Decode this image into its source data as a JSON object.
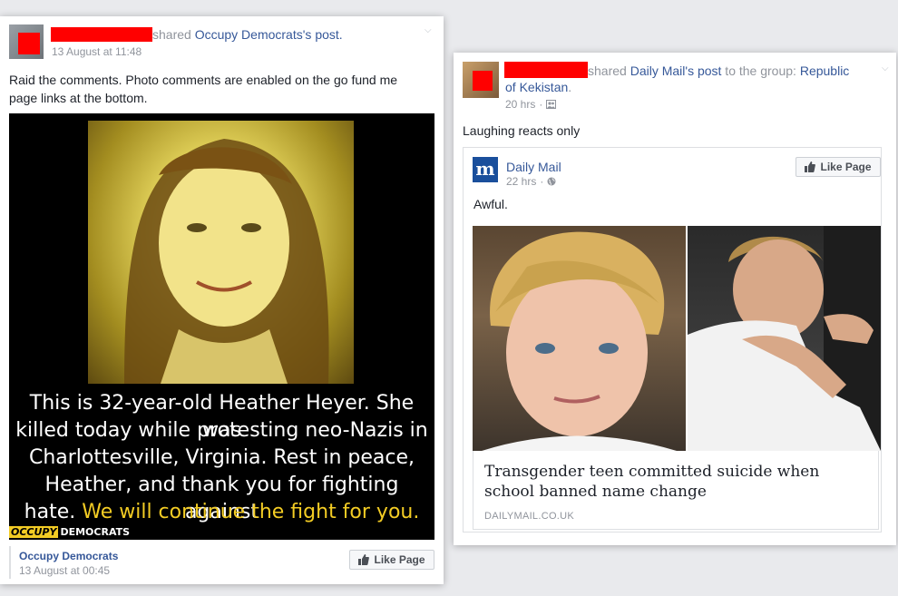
{
  "left_post": {
    "shared_prefix": "shared ",
    "page_name": "Occupy Democrats",
    "shared_suffix": "'s post.",
    "timestamp": "13 August at 11:48",
    "text_line1": "Raid the comments. Photo comments are enabled on the go fund me",
    "text_line2": "page links at the bottom.",
    "caption_line1": "This is 32-year-old Heather Heyer. She was",
    "caption_line2": "killed today while protesting neo-Nazis in",
    "caption_line3": "Charlottesville, Virginia. Rest in peace,",
    "caption_line4": "Heather, and thank you for fighting against",
    "caption_line5_white": "hate. ",
    "caption_line5_yellow": "We will continue the fight for you.",
    "logo_box": "OCCUPY",
    "logo_text": "DEMOCRATS",
    "source_name": "Occupy Democrats",
    "source_time": "13 August at 00:45",
    "like_page": "Like Page"
  },
  "right_post": {
    "shared_prefix": "shared ",
    "page_name": "Daily Mail",
    "shared_mid": "'s ",
    "post_link": "post",
    "group_prefix": " to the group: ",
    "group_line1": "Republic",
    "group_line2": "of Kekistan",
    "group_period": ".",
    "timestamp": "20 hrs",
    "text": "Laughing reacts only",
    "inner_page_name": "Daily Mail",
    "inner_time": "22 hrs",
    "inner_text": "Awful.",
    "like_page": "Like Page",
    "link_title": "Transgender teen committed suicide when school banned name change",
    "link_domain": "DAILYMAIL.CO.UK",
    "logo_letter": "m"
  },
  "icons": {
    "chevron": "chevron-down-icon",
    "like": "thumbs-up-icon",
    "globe": "globe-icon",
    "audience": "group-audience-icon"
  },
  "colors": {
    "link": "#365899",
    "redaction": "#ff0000",
    "accent_yellow": "#f3cc24"
  }
}
